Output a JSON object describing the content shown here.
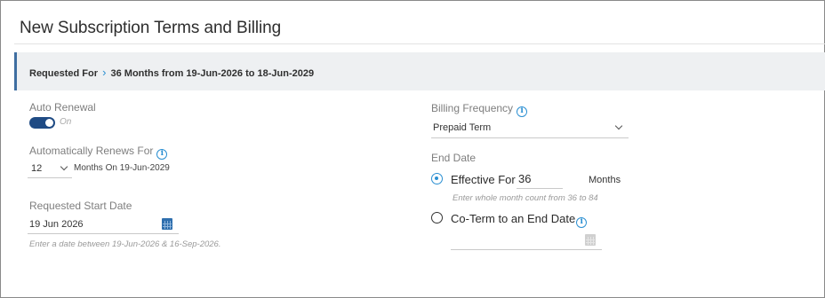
{
  "page": {
    "title": "New Subscription Terms and Billing"
  },
  "requested_for": {
    "label": "Requested For",
    "chevron": "›",
    "value": "36 Months from 19-Jun-2026 to 18-Jun-2029"
  },
  "auto_renewal": {
    "label": "Auto Renewal",
    "state_text": "On",
    "enabled": true
  },
  "renews_for": {
    "label": "Automatically Renews For",
    "value": "12",
    "suffix": "Months On 19-Jun-2029"
  },
  "start_date": {
    "label": "Requested Start Date",
    "value": "19 Jun 2026",
    "hint": "Enter a date between 19-Jun-2026 & 16-Sep-2026."
  },
  "billing_frequency": {
    "label": "Billing Frequency",
    "value": "Prepaid Term"
  },
  "end_date": {
    "label": "End Date",
    "effective_for": {
      "label": "Effective For",
      "value": "36",
      "unit": "Months",
      "hint": "Enter whole month count from 36 to 84",
      "selected": true
    },
    "co_term": {
      "label": "Co-Term to an End Date",
      "value": "",
      "selected": false
    }
  },
  "icons": {
    "info": "i",
    "accent_color": "#2a8fd2",
    "toggle_color": "#1f4b84",
    "bar_accent": "#3f6ea1"
  }
}
